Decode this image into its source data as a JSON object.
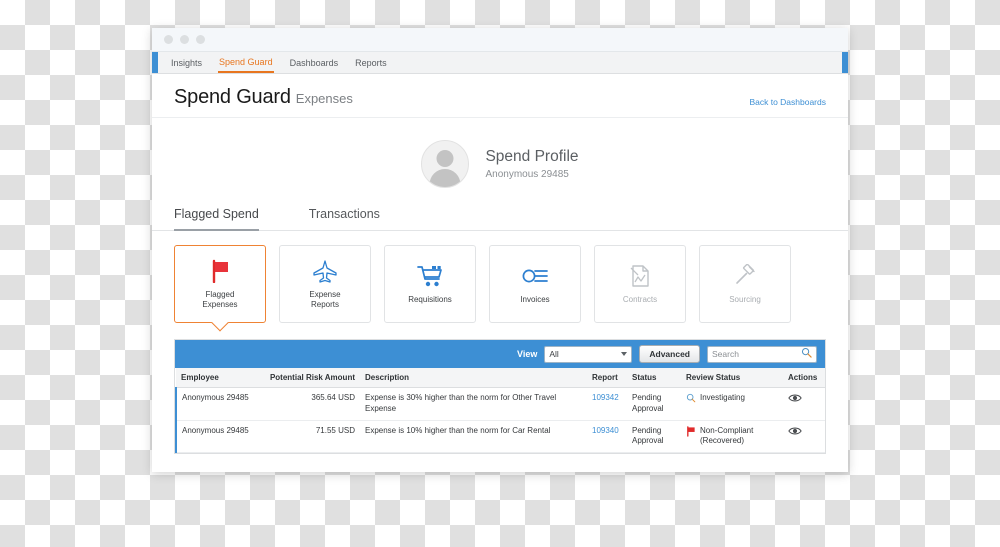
{
  "window": {
    "dots": [
      "window-dot",
      "window-dot",
      "window-dot"
    ]
  },
  "nav": {
    "items": [
      {
        "label": "Insights",
        "active": false
      },
      {
        "label": "Spend Guard",
        "active": true
      },
      {
        "label": "Dashboards",
        "active": false
      },
      {
        "label": "Reports",
        "active": false
      }
    ]
  },
  "header": {
    "title": "Spend Guard",
    "subtitle": "Expenses",
    "back_link": "Back to Dashboards"
  },
  "profile": {
    "name": "Spend Profile",
    "subtitle": "Anonymous 29485",
    "avatar_icon": "person-avatar-icon"
  },
  "tabs": [
    {
      "label": "Flagged Spend",
      "active": true
    },
    {
      "label": "Transactions",
      "active": false
    }
  ],
  "cards": [
    {
      "label": "Flagged\nExpenses",
      "icon": "flag-icon",
      "selected": true,
      "disabled": false
    },
    {
      "label": "Expense\nReports",
      "icon": "airplane-icon",
      "selected": false,
      "disabled": false
    },
    {
      "label": "Requisitions",
      "icon": "shopping-cart-icon",
      "selected": false,
      "disabled": false
    },
    {
      "label": "Invoices",
      "icon": "invoice-icon",
      "selected": false,
      "disabled": false
    },
    {
      "label": "Contracts",
      "icon": "contract-document-icon",
      "selected": false,
      "disabled": true
    },
    {
      "label": "Sourcing",
      "icon": "gavel-icon",
      "selected": false,
      "disabled": true
    }
  ],
  "toolbar": {
    "view_label": "View",
    "view_value": "All",
    "advanced_label": "Advanced",
    "search_placeholder": "Search",
    "search_value": "",
    "search_icon": "magnifier-icon",
    "accent_color": "#3d8fd4"
  },
  "table": {
    "columns": [
      "Employee",
      "Potential Risk Amount",
      "Description",
      "Report",
      "Status",
      "Review Status",
      "Actions"
    ],
    "rows": [
      {
        "employee": "Anonymous 29485",
        "amount": "365.64 USD",
        "description": "Expense is 30% higher than the norm for Other Travel Expense",
        "report": "109342",
        "status": "Pending Approval",
        "review_status": "Investigating",
        "review_icon": "magnifier-icon",
        "action_icon": "eye-icon"
      },
      {
        "employee": "Anonymous 29485",
        "amount": "71.55 USD",
        "description": "Expense is 10% higher than the norm for Car Rental",
        "report": "109340",
        "status": "Pending Approval",
        "review_status": "Non-Compliant (Recovered)",
        "review_icon": "red-flag-icon",
        "action_icon": "eye-icon"
      }
    ]
  },
  "colors": {
    "brand_blue": "#3d8fd4",
    "accent_orange": "#ef8334",
    "flag_red": "#e02b2b"
  }
}
